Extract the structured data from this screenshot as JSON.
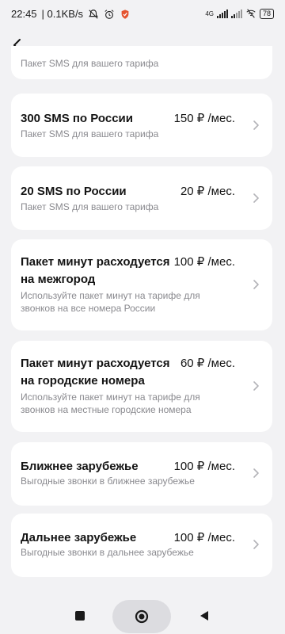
{
  "status": {
    "time": "22:45",
    "speed": "| 0.1KB/s",
    "network": "4G",
    "battery": "78"
  },
  "cards": [
    {
      "title": "",
      "price": "",
      "subtitle": "Пакет SMS для вашего тарифа"
    },
    {
      "title": "300 SMS по России",
      "price": "150 ₽ /мес.",
      "subtitle": "Пакет SMS для вашего тарифа"
    },
    {
      "title": "20 SMS по России",
      "price": "20 ₽ /мес.",
      "subtitle": "Пакет SMS для вашего тарифа"
    },
    {
      "title_lines": [
        "Пакет минут расходуется",
        "на межгород"
      ],
      "price": "100 ₽ /мес.",
      "subtitle_lines": [
        "Используйте пакет минут на тарифе для",
        "звонков на все номера России"
      ]
    },
    {
      "title_lines": [
        "Пакет минут расходуется",
        "на городские номера"
      ],
      "price": "60 ₽ /мес.",
      "subtitle_lines": [
        "Используйте пакет минут на тарифе для",
        "звонков на местные городские номера"
      ]
    },
    {
      "title": "Ближнее зарубежье",
      "price": "100 ₽ /мес.",
      "subtitle": "Выгодные звонки в ближнее зарубежье"
    },
    {
      "title": "Дальнее зарубежье",
      "price": "100 ₽ /мес.",
      "subtitle": "Выгодные звонки в дальнее зарубежье"
    }
  ]
}
